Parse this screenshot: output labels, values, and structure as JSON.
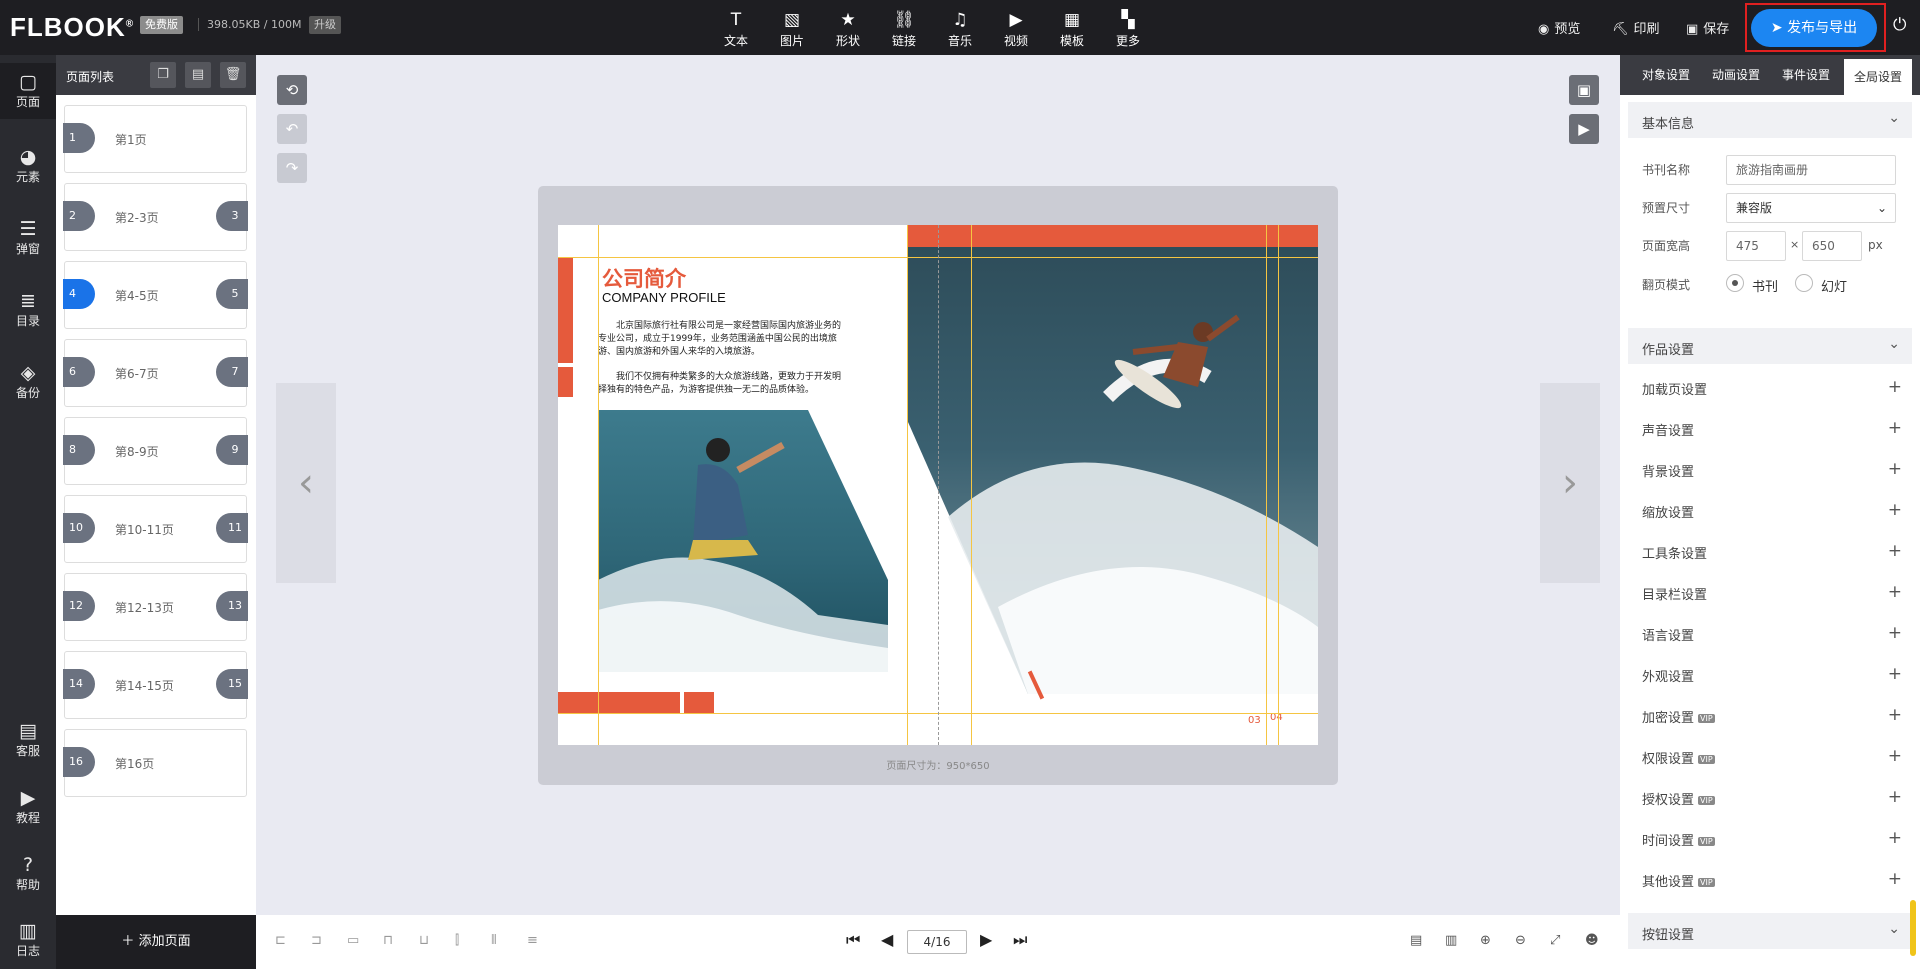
{
  "topbar": {
    "logo": "FLBOOK",
    "logo_mark": "®",
    "edition_badge": "免费版",
    "storage": "398.05KB / 100M",
    "upgrade": "升级",
    "tools": [
      {
        "label": "文本",
        "icon": "T",
        "name": "text-tool"
      },
      {
        "label": "图片",
        "icon": "▧",
        "name": "image-tool"
      },
      {
        "label": "形状",
        "icon": "★",
        "name": "shape-tool"
      },
      {
        "label": "链接",
        "icon": "⛓",
        "name": "link-tool"
      },
      {
        "label": "音乐",
        "icon": "♫",
        "name": "music-tool"
      },
      {
        "label": "视频",
        "icon": "▶",
        "name": "video-tool"
      },
      {
        "label": "模板",
        "icon": "▦",
        "name": "template-tool"
      },
      {
        "label": "更多",
        "icon": "▚",
        "name": "more-tool"
      }
    ],
    "preview": "预览",
    "print": "印刷",
    "save": "保存",
    "publish": "发布与导出"
  },
  "leftnav": [
    {
      "label": "页面",
      "icon": "▢",
      "name": "nav-pages"
    },
    {
      "label": "元素",
      "icon": "◕",
      "name": "nav-elements"
    },
    {
      "label": "弹窗",
      "icon": "☰",
      "name": "nav-popup"
    },
    {
      "label": "目录",
      "icon": "≣",
      "name": "nav-toc"
    },
    {
      "label": "备份",
      "icon": "◈",
      "name": "nav-backup"
    },
    {
      "label": "客服",
      "icon": "▤",
      "name": "nav-support"
    },
    {
      "label": "教程",
      "icon": "▶",
      "name": "nav-tutorial"
    },
    {
      "label": "帮助",
      "icon": "?",
      "name": "nav-help"
    },
    {
      "label": "日志",
      "icon": "▥",
      "name": "nav-log"
    }
  ],
  "pagelist": {
    "title": "页面列表",
    "pages": [
      {
        "label": "第1页",
        "left": "1",
        "right": ""
      },
      {
        "label": "第2-3页",
        "left": "2",
        "right": "3"
      },
      {
        "label": "第4-5页",
        "left": "4",
        "right": "5"
      },
      {
        "label": "第6-7页",
        "left": "6",
        "right": "7"
      },
      {
        "label": "第8-9页",
        "left": "8",
        "right": "9"
      },
      {
        "label": "第10-11页",
        "left": "10",
        "right": "11"
      },
      {
        "label": "第12-13页",
        "left": "12",
        "right": "13"
      },
      {
        "label": "第14-15页",
        "left": "14",
        "right": "15"
      },
      {
        "label": "第16页",
        "left": "16",
        "right": ""
      }
    ],
    "active_index": 2,
    "add_page": "添加页面"
  },
  "canvas": {
    "heading_cn": "公司简介",
    "heading_en": "COMPANY PROFILE",
    "paragraph1": "北京国际旅行社有限公司是一家经营国际国内旅游业务的专业公司，成立于1999年，业务范围涵盖中国公民的出境旅游、国内旅游和外国人来华的入境旅游。",
    "paragraph2": "我们不仅拥有种类繁多的大众旅游线路，更致力于开发明择独有的特色产品，为游客提供独一无二的品质体验。",
    "page_num_left": "03",
    "page_num_right": "04",
    "size_hint": "页面尺寸为：950*650"
  },
  "bottombar": {
    "page_indicator": "4/16"
  },
  "rightpanel": {
    "tabs": [
      "对象设置",
      "动画设置",
      "事件设置",
      "全局设置"
    ],
    "active_tab": 3,
    "basic_info": "基本信息",
    "book_name_label": "书刊名称",
    "book_name_value": "旅游指南画册",
    "preset_size_label": "预置尺寸",
    "preset_size_value": "兼容版",
    "page_size_label": "页面宽高",
    "page_width": "475",
    "page_height": "650",
    "times": "×",
    "unit": "px",
    "flip_mode_label": "翻页模式",
    "flip_mode_book": "书刊",
    "flip_mode_slide": "幻灯",
    "work_settings": "作品设置",
    "items": [
      {
        "label": "加载页设置",
        "vip": false
      },
      {
        "label": "声音设置",
        "vip": false
      },
      {
        "label": "背景设置",
        "vip": false
      },
      {
        "label": "缩放设置",
        "vip": false
      },
      {
        "label": "工具条设置",
        "vip": false
      },
      {
        "label": "目录栏设置",
        "vip": false
      },
      {
        "label": "语言设置",
        "vip": false
      },
      {
        "label": "外观设置",
        "vip": false
      },
      {
        "label": "加密设置",
        "vip": true
      },
      {
        "label": "权限设置",
        "vip": true
      },
      {
        "label": "授权设置",
        "vip": true
      },
      {
        "label": "时间设置",
        "vip": true
      },
      {
        "label": "其他设置",
        "vip": true
      }
    ],
    "vip_label": "VIP",
    "button_settings": "按钮设置"
  },
  "colors": {
    "accent": "#1c86f2",
    "brand_red": "#e55a3c",
    "highlight_border": "#e02020"
  }
}
